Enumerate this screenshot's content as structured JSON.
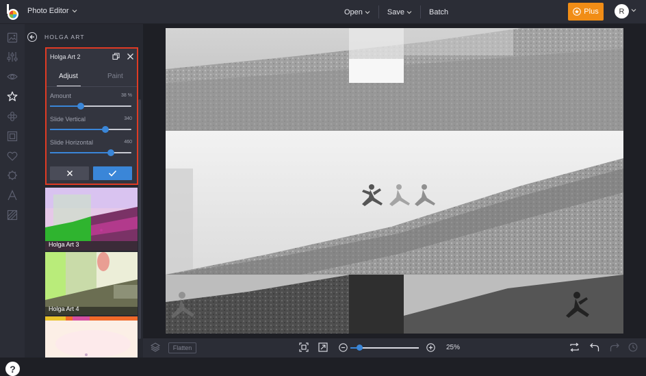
{
  "app": {
    "title": "Photo Editor"
  },
  "top_menu": {
    "open": "Open",
    "save": "Save",
    "batch": "Batch"
  },
  "plus_button": "Plus",
  "user": {
    "initial": "R"
  },
  "panel": {
    "section_title": "HOLGA ART",
    "card": {
      "title": "Holga Art 2",
      "tabs": [
        "Adjust",
        "Paint"
      ],
      "active_tab": "Adjust",
      "sliders": [
        {
          "label": "Amount",
          "value": "38 %",
          "fraction": 0.38
        },
        {
          "label": "Slide Vertical",
          "value": "340",
          "fraction": 0.68
        },
        {
          "label": "Slide Horizontal",
          "value": "460",
          "fraction": 0.75
        }
      ]
    },
    "thumbnails": [
      {
        "label": "Holga Art 3"
      },
      {
        "label": "Holga Art 4"
      }
    ]
  },
  "bottombar": {
    "flatten": "Flatten",
    "zoom": "25%",
    "zoom_fraction": 0.04
  },
  "colors": {
    "accent": "#3a86d8",
    "plus": "#f18d16",
    "highlight": "#e03b24"
  }
}
